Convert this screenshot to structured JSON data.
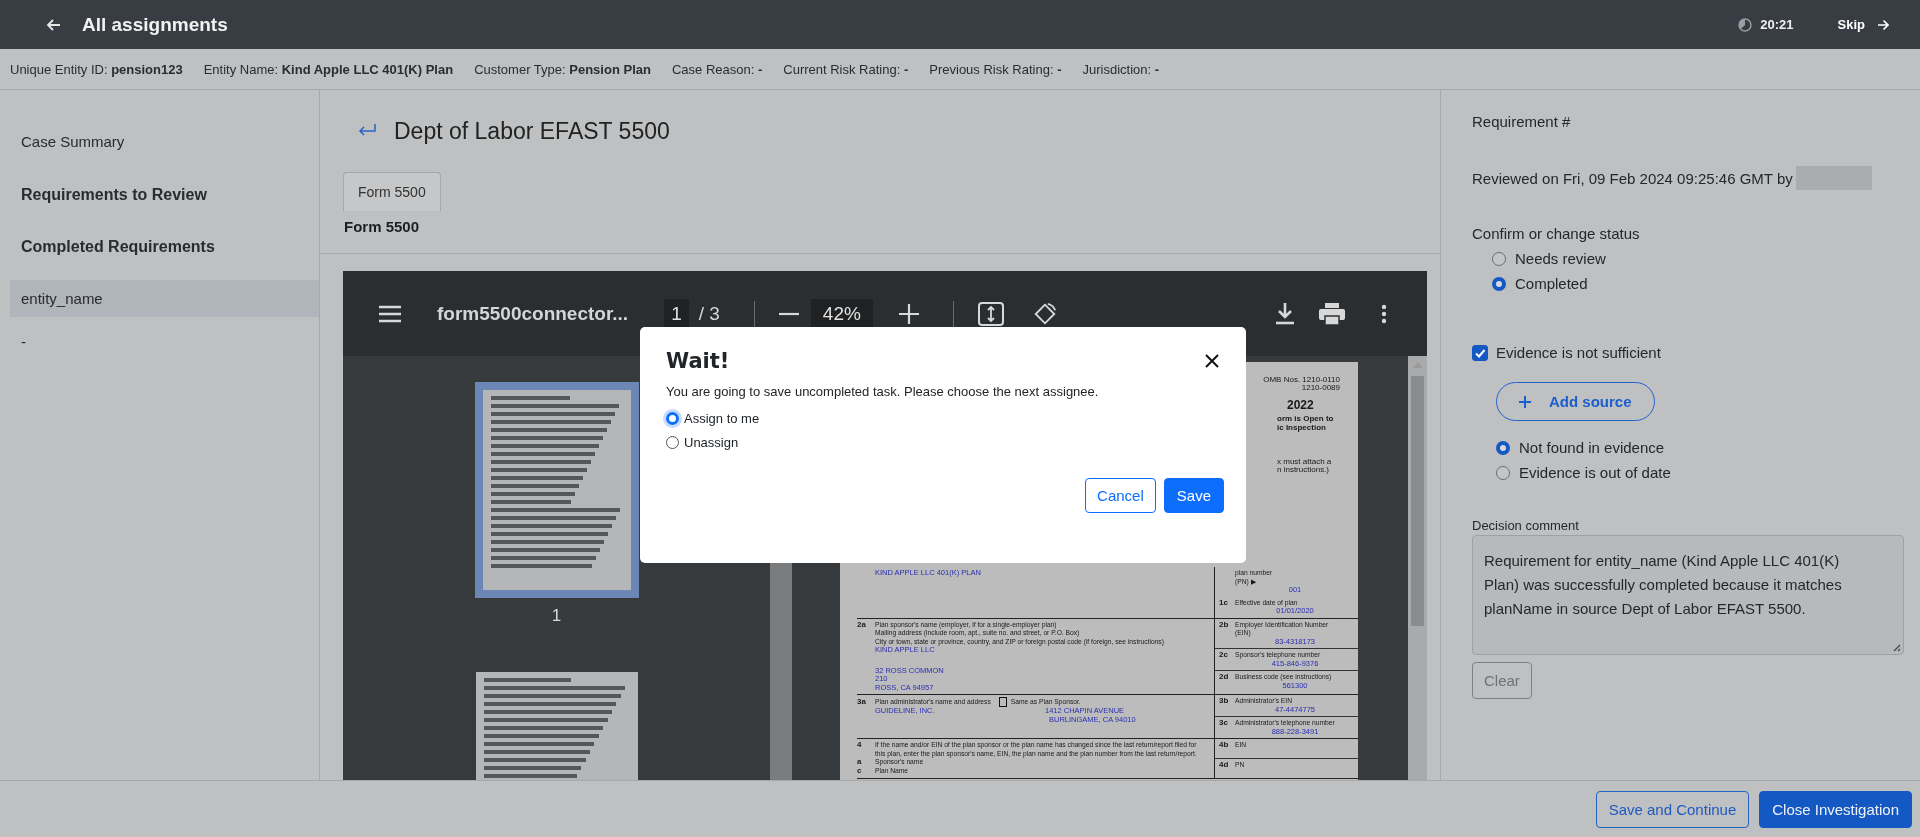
{
  "top_bar": {
    "title": "All assignments",
    "timer": "20:21",
    "skip": "Skip"
  },
  "info_bar": [
    "Unique Entity ID: **pension123**",
    "Entity Name: **Kind Apple LLC 401(K) Plan**",
    "Customer Type: **Pension Plan**",
    "Case Reason: **-**",
    "Current Risk Rating: **-**",
    "Previous Risk Rating: **-**",
    "Jurisdiction: **-**"
  ],
  "sidebar": {
    "items": [
      {
        "label": "Case Summary",
        "kind": "link",
        "selected": false
      },
      {
        "label": "Requirements to Review",
        "kind": "heading",
        "selected": false
      },
      {
        "label": "Completed Requirements",
        "kind": "heading",
        "selected": false
      },
      {
        "label": "entity_name",
        "kind": "link",
        "selected": true
      },
      {
        "label": "-",
        "kind": "link",
        "selected": false
      }
    ]
  },
  "document": {
    "title": "Dept of Labor EFAST 5500",
    "tabs": [
      {
        "label": "Form 5500",
        "selected": true
      }
    ],
    "section_title": "Form 5500",
    "viewer": {
      "file_name": "form5500connector...",
      "page": "1",
      "page_count": "/ 3",
      "zoom": "42%",
      "thumbnails": [
        {
          "label": "1",
          "selected": true
        },
        {
          "selected": false
        }
      ],
      "page_header": [
        {
          "kind": "small",
          "text": "OMB Nos. 1210-0110"
        },
        {
          "kind": "small",
          "text": "1210-0089"
        },
        {
          "kind": "year",
          "text": "2022"
        },
        {
          "kind": "bold",
          "text": "orm is Open to"
        },
        {
          "kind": "bold",
          "text": "ic Inspection"
        },
        {
          "kind": "gap",
          "text": "x must attach a"
        },
        {
          "kind": "small",
          "text": "n instructions.)"
        }
      ],
      "form_rows": [
        {
          "left": [
            {
              "kind": "value",
              "texts": [
                "KIND APPLE LLC 401(K) PLAN"
              ]
            }
          ],
          "right": [
            {
              "lines": [
                "plan number",
                "(PN) ▶"
              ],
              "value": "001"
            }
          ]
        },
        {
          "left": [],
          "right": [
            {
              "num": "1c",
              "lines": [
                "Effective date of plan"
              ],
              "value": "01/01/2020"
            }
          ]
        },
        {
          "left": [
            {
              "kind": "label",
              "num": "2a",
              "texts": [
                "Plan sponsor's name (employer, if for a single-employer plan)"
              ]
            },
            {
              "kind": "label",
              "texts": [
                "Mailing address (include room, apt., suite no. and street, or P.O. Box)"
              ]
            },
            {
              "kind": "label",
              "texts": [
                "City or town, state or province, country, and ZIP or foreign postal code (if foreign, see instructions)"
              ]
            },
            {
              "kind": "value",
              "texts": [
                "KIND APPLE LLC"
              ]
            },
            {
              "kind": "spacer"
            },
            {
              "kind": "value",
              "texts": [
                "32 ROSS COMMON"
              ]
            },
            {
              "kind": "value",
              "texts": [
                "210"
              ]
            },
            {
              "kind": "value",
              "texts": [
                "ROSS, CA 94957"
              ]
            }
          ],
          "right": [
            {
              "num": "2b",
              "lines": [
                "Employer Identification Number",
                "(EIN)"
              ],
              "value": "83-4318173"
            },
            {
              "num": "2c",
              "lines": [
                "Sponsor's telephone number"
              ],
              "value": "415-846-9376"
            },
            {
              "num": "2d",
              "lines": [
                "Business code (see instructions)"
              ],
              "value": "561300"
            }
          ]
        },
        {
          "left": [
            {
              "kind": "label",
              "num": "3a",
              "texts": [
                "Plan administrator's name and address"
              ],
              "checkbox": {
                "label": "Same as Plan Sponsor.",
                "checked": false
              }
            },
            {
              "kind": "value",
              "texts": [
                "GUIDELINE, INC.",
                "1412 CHAPIN AVENUE"
              ]
            },
            {
              "kind": "value_second",
              "texts": [
                "BURLINGAME, CA 94010"
              ]
            }
          ],
          "right": [
            {
              "num": "3b",
              "lines": [
                "Administrator's EIN"
              ],
              "value": "47-4474775"
            },
            {
              "num": "3c",
              "lines": [
                "Administrator's telephone number"
              ],
              "value": "888-228-3491"
            }
          ]
        },
        {
          "left": [
            {
              "kind": "label",
              "num": "4",
              "texts": [
                "If the name and/or EIN of the plan sponsor or the plan name has changed since the last return/report filed for"
              ]
            },
            {
              "kind": "label",
              "texts": [
                "this plan, enter the plan sponsor's name, EIN, the plan name and the plan number from the last return/report."
              ]
            },
            {
              "kind": "label",
              "num": "a",
              "texts": [
                "Sponsor's name"
              ]
            },
            {
              "kind": "label",
              "num": "c",
              "texts": [
                "Plan Name"
              ]
            }
          ],
          "right": [
            {
              "num": "4b",
              "lines": [
                "EIN"
              ]
            },
            {
              "num": "4d",
              "lines": [
                "PN"
              ]
            }
          ]
        }
      ]
    }
  },
  "right_panel": {
    "heading": "Requirement #",
    "reviewed": "Reviewed on Fri, 09 Feb 2024 09:25:46 GMT by",
    "status_label": "Confirm or change status",
    "status_options": [
      {
        "label": "Needs review",
        "selected": false
      },
      {
        "label": "Completed",
        "selected": true
      }
    ],
    "insufficient": {
      "label": "Evidence is not sufficient",
      "checked": true
    },
    "add_source": "Add source",
    "reason_options": [
      {
        "label": "Not found in evidence",
        "selected": true
      },
      {
        "label": "Evidence is out of date",
        "selected": false
      }
    ],
    "comment_label": "Decision comment",
    "comment": "Requirement for entity_name (Kind Apple LLC 401(K) Plan) was successfully completed because it matches planName in source Dept of Labor EFAST 5500.",
    "clear": "Clear"
  },
  "footer": {
    "buttons": [
      {
        "label": "Save and Continue",
        "kind": "outline"
      },
      {
        "label": "Close Investigation",
        "kind": "primary"
      }
    ]
  },
  "modal": {
    "title": "Wait!",
    "message": "You are going to save uncompleted task. Please choose the next assignee.",
    "options": [
      {
        "label": "Assign to me",
        "selected": true
      },
      {
        "label": "Unassign",
        "selected": false
      }
    ],
    "buttons": [
      {
        "label": "Cancel",
        "kind": "outline"
      },
      {
        "label": "Save",
        "kind": "primary"
      }
    ]
  }
}
